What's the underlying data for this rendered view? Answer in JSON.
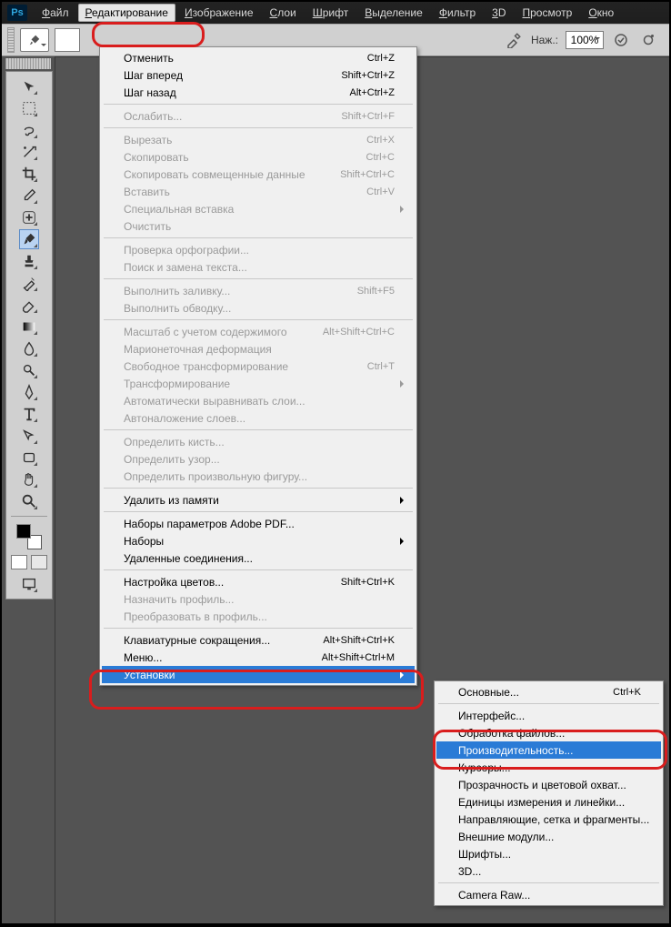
{
  "app": {
    "logo": "Ps"
  },
  "menubar": [
    "Файл",
    "Редактирование",
    "Изображение",
    "Слои",
    "Шрифт",
    "Выделение",
    "Фильтр",
    "3D",
    "Просмотр",
    "Окно"
  ],
  "options": {
    "pressure_label": "Наж.:",
    "pressure_value": "100%"
  },
  "tools": [
    "move",
    "marquee",
    "lasso",
    "wand",
    "crop",
    "eyedropper",
    "heal",
    "brush",
    "stamp",
    "history-brush",
    "eraser",
    "gradient",
    "blur",
    "dodge",
    "pen",
    "type",
    "path-select",
    "rectangle",
    "hand",
    "zoom"
  ],
  "edit_menu": [
    {
      "t": "Отменить",
      "s": "Ctrl+Z"
    },
    {
      "t": "Шаг вперед",
      "s": "Shift+Ctrl+Z"
    },
    {
      "t": "Шаг назад",
      "s": "Alt+Ctrl+Z"
    },
    "-",
    {
      "t": "Ослабить...",
      "s": "Shift+Ctrl+F",
      "d": true
    },
    "-",
    {
      "t": "Вырезать",
      "s": "Ctrl+X",
      "d": true
    },
    {
      "t": "Скопировать",
      "s": "Ctrl+C",
      "d": true
    },
    {
      "t": "Скопировать совмещенные данные",
      "s": "Shift+Ctrl+C",
      "d": true
    },
    {
      "t": "Вставить",
      "s": "Ctrl+V",
      "d": true
    },
    {
      "t": "Специальная вставка",
      "a": true,
      "d": true
    },
    {
      "t": "Очистить",
      "d": true
    },
    "-",
    {
      "t": "Проверка орфографии...",
      "d": true
    },
    {
      "t": "Поиск и замена текста...",
      "d": true
    },
    "-",
    {
      "t": "Выполнить заливку...",
      "s": "Shift+F5",
      "d": true
    },
    {
      "t": "Выполнить обводку...",
      "d": true
    },
    "-",
    {
      "t": "Масштаб с учетом содержимого",
      "s": "Alt+Shift+Ctrl+C",
      "d": true
    },
    {
      "t": "Марионеточная деформация",
      "d": true
    },
    {
      "t": "Свободное трансформирование",
      "s": "Ctrl+T",
      "d": true
    },
    {
      "t": "Трансформирование",
      "a": true,
      "d": true
    },
    {
      "t": "Автоматически выравнивать слои...",
      "d": true
    },
    {
      "t": "Автоналожение слоев...",
      "d": true
    },
    "-",
    {
      "t": "Определить кисть...",
      "d": true
    },
    {
      "t": "Определить узор...",
      "d": true
    },
    {
      "t": "Определить произвольную фигуру...",
      "d": true
    },
    "-",
    {
      "t": "Удалить из памяти",
      "a": true
    },
    "-",
    {
      "t": "Наборы параметров Adobe PDF..."
    },
    {
      "t": "Наборы",
      "a": true
    },
    {
      "t": "Удаленные соединения..."
    },
    "-",
    {
      "t": "Настройка цветов...",
      "s": "Shift+Ctrl+K"
    },
    {
      "t": "Назначить профиль...",
      "d": true
    },
    {
      "t": "Преобразовать в профиль...",
      "d": true
    },
    "-",
    {
      "t": "Клавиатурные сокращения...",
      "s": "Alt+Shift+Ctrl+K"
    },
    {
      "t": "Меню...",
      "s": "Alt+Shift+Ctrl+M"
    },
    {
      "t": "Установки",
      "a": true,
      "sel": true
    }
  ],
  "settings_menu": [
    {
      "t": "Основные...",
      "s": "Ctrl+K"
    },
    "-",
    {
      "t": "Интерфейс..."
    },
    {
      "t": "Обработка файлов..."
    },
    {
      "t": "Производительность...",
      "sel": true
    },
    {
      "t": "Курсоры..."
    },
    {
      "t": "Прозрачность и цветовой охват..."
    },
    {
      "t": "Единицы измерения и линейки..."
    },
    {
      "t": "Направляющие, сетка и фрагменты..."
    },
    {
      "t": "Внешние модули..."
    },
    {
      "t": "Шрифты..."
    },
    {
      "t": "3D..."
    },
    "-",
    {
      "t": "Camera Raw..."
    }
  ]
}
